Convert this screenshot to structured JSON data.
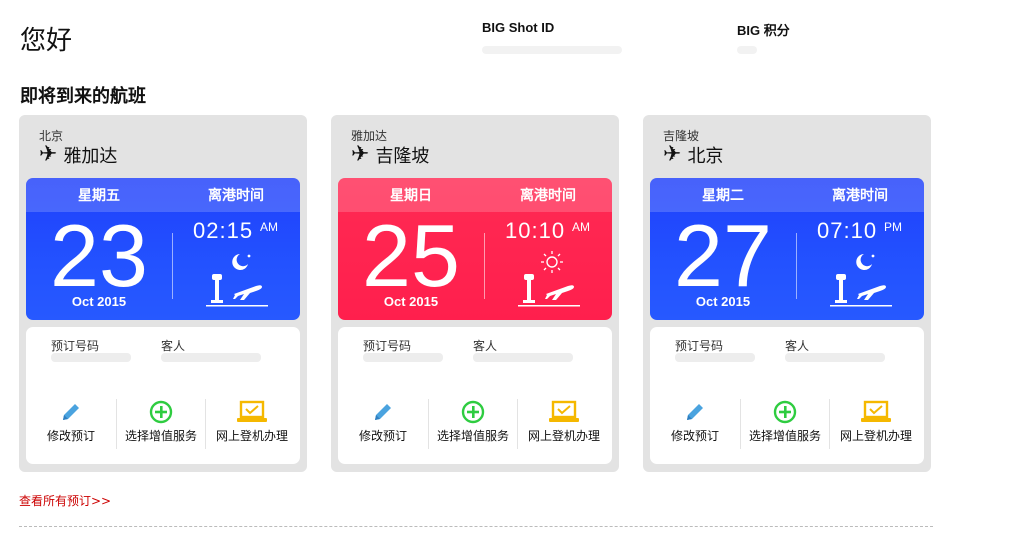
{
  "header": {
    "greeting": "您好",
    "member_id_label": "BIG Shot ID",
    "points_label": "BIG 积分"
  },
  "section_title": "即将到来的航班",
  "flights": [
    {
      "origin": "北京",
      "destination": "雅加达",
      "theme": "blue",
      "weekday": "星期五",
      "departure_label": "离港时间",
      "day": "23",
      "month_year": "Oct 2015",
      "time": "02:15",
      "ampm": "AM",
      "sky_icon": "moon-icon",
      "booking_ref_label": "预订号码",
      "passenger_label": "客人",
      "actions": [
        "修改预订",
        "选择增值服务",
        "网上登机办理"
      ]
    },
    {
      "origin": "雅加达",
      "destination": "吉隆坡",
      "theme": "red",
      "weekday": "星期日",
      "departure_label": "离港时间",
      "day": "25",
      "month_year": "Oct 2015",
      "time": "10:10",
      "ampm": "AM",
      "sky_icon": "sun-icon",
      "booking_ref_label": "预订号码",
      "passenger_label": "客人",
      "actions": [
        "修改预订",
        "选择增值服务",
        "网上登机办理"
      ]
    },
    {
      "origin": "吉隆坡",
      "destination": "北京",
      "theme": "blue",
      "weekday": "星期二",
      "departure_label": "离港时间",
      "day": "27",
      "month_year": "Oct 2015",
      "time": "07:10",
      "ampm": "PM",
      "sky_icon": "moon-icon",
      "booking_ref_label": "预订号码",
      "passenger_label": "客人",
      "actions": [
        "修改预订",
        "选择增值服务",
        "网上登机办理"
      ]
    }
  ],
  "view_all_link": "查看所有预订>>",
  "colors": {
    "blue_panel": "#2352ff",
    "red_panel": "#ff1f4d",
    "card_bg": "#e3e3e3",
    "link": "#cc0000",
    "edit_icon": "#4aa3df",
    "addon_icon": "#2ecc40",
    "checkin_icon": "#f5b800"
  }
}
